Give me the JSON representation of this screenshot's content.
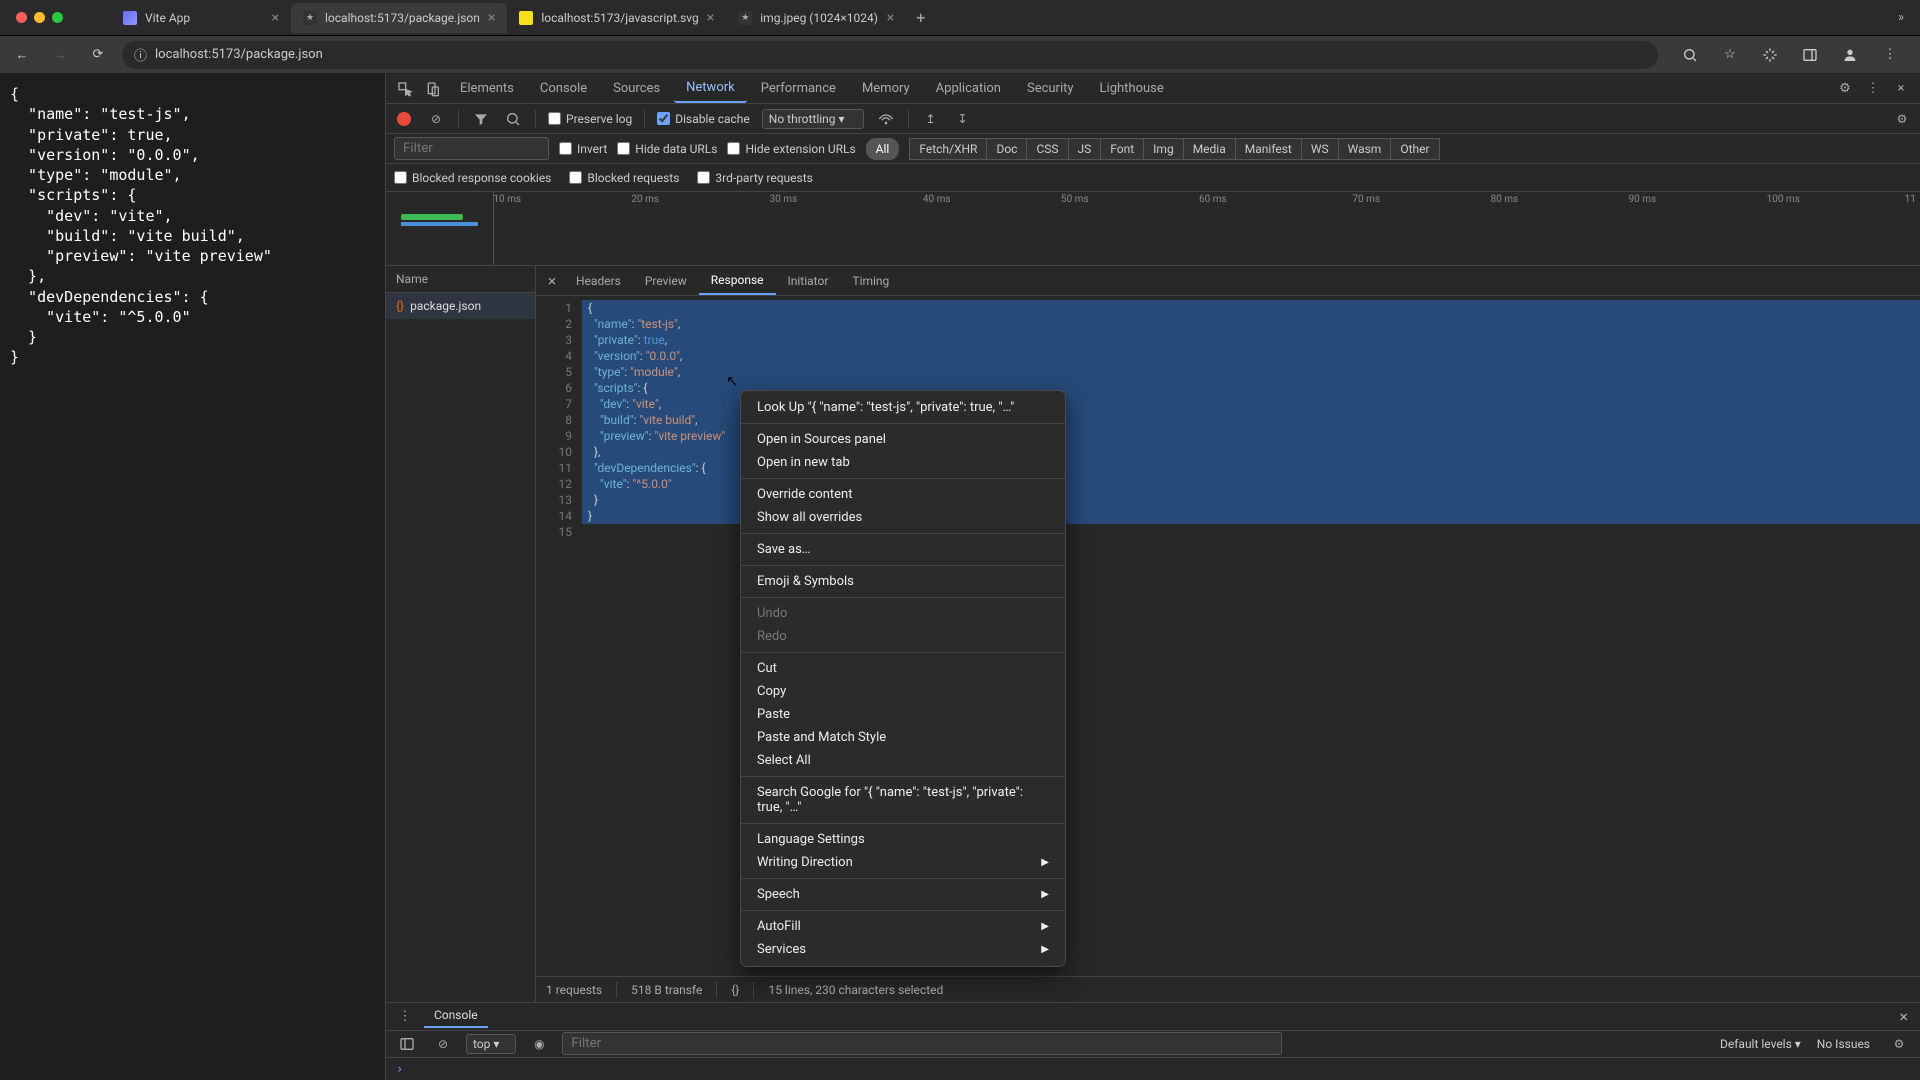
{
  "browser": {
    "tabs": [
      {
        "title": "Vite App",
        "active": false
      },
      {
        "title": "localhost:5173/package.json",
        "active": true
      },
      {
        "title": "localhost:5173/javascript.svg",
        "active": false
      },
      {
        "title": "img.jpeg (1024×1024)",
        "active": false
      }
    ],
    "url": "localhost:5173/package.json"
  },
  "page_json": "{\n  \"name\": \"test-js\",\n  \"private\": true,\n  \"version\": \"0.0.0\",\n  \"type\": \"module\",\n  \"scripts\": {\n    \"dev\": \"vite\",\n    \"build\": \"vite build\",\n    \"preview\": \"vite preview\"\n  },\n  \"devDependencies\": {\n    \"vite\": \"^5.0.0\"\n  }\n}",
  "devtools": {
    "tabs": [
      "Elements",
      "Console",
      "Sources",
      "Network",
      "Performance",
      "Memory",
      "Application",
      "Security",
      "Lighthouse"
    ],
    "active_tab": "Network",
    "network": {
      "preserve_log": false,
      "disable_cache": true,
      "throttle": "No throttling",
      "filter_placeholder": "Filter",
      "invert": false,
      "hide_data_urls": false,
      "hide_ext_urls": false,
      "types": [
        "All",
        "Fetch/XHR",
        "Doc",
        "CSS",
        "JS",
        "Font",
        "Img",
        "Media",
        "Manifest",
        "WS",
        "Wasm",
        "Other"
      ],
      "active_type": "All",
      "blocked_cookies": false,
      "blocked_requests": false,
      "third_party": false,
      "timeline_ticks": [
        "10 ms",
        "20 ms",
        "30 ms",
        "40 ms",
        "50 ms",
        "60 ms",
        "70 ms",
        "80 ms",
        "90 ms",
        "100 ms",
        "11"
      ],
      "list_header": "Name",
      "requests": [
        "package.json"
      ],
      "detail_tabs": [
        "Headers",
        "Preview",
        "Response",
        "Initiator",
        "Timing"
      ],
      "active_detail": "Response",
      "response_lines": [
        "{",
        "  \"name\": \"test-js\",",
        "  \"private\": true,",
        "  \"version\": \"0.0.0\",",
        "  \"type\": \"module\",",
        "  \"scripts\": {",
        "    \"dev\": \"vite\",",
        "    \"build\": \"vite build\",",
        "    \"preview\": \"vite preview\"",
        "  },",
        "  \"devDependencies\": {",
        "    \"vite\": \"^5.0.0\"",
        "  }",
        "}",
        ""
      ],
      "status_requests": "1 requests",
      "status_transfer": "518 B transfe",
      "status_selection": "15 lines, 230 characters selected"
    },
    "console": {
      "tab": "Console",
      "context": "top",
      "filter_placeholder": "Filter",
      "levels": "Default levels",
      "issues": "No Issues",
      "prompt": "›"
    }
  },
  "context_menu": {
    "lookup": "Look Up \"{   \"name\": \"test-js\",   \"private\": true,   \"…\"",
    "open_sources": "Open in Sources panel",
    "open_tab": "Open in new tab",
    "override": "Override content",
    "show_overrides": "Show all overrides",
    "save_as": "Save as…",
    "emoji": "Emoji & Symbols",
    "undo": "Undo",
    "redo": "Redo",
    "cut": "Cut",
    "copy": "Copy",
    "paste": "Paste",
    "paste_match": "Paste and Match Style",
    "select_all": "Select All",
    "search_google": "Search Google for \"{   \"name\": \"test-js\",   \"private\": true,   \"…\"",
    "language": "Language Settings",
    "writing": "Writing Direction",
    "speech": "Speech",
    "autofill": "AutoFill",
    "services": "Services"
  }
}
